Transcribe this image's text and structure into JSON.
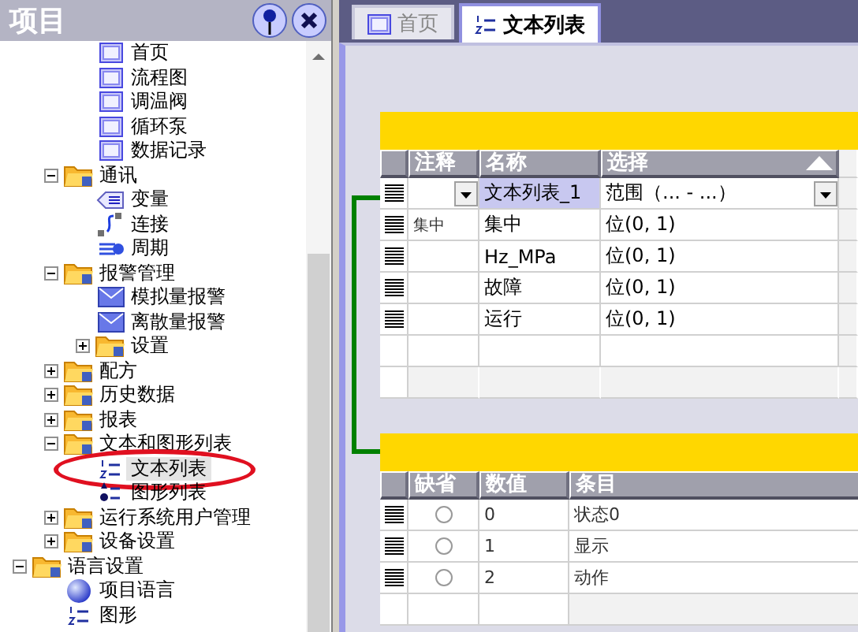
{
  "project_panel": {
    "title": "项目",
    "tree": [
      {
        "children": [
          {
            "children": [
              {
                "label": "首页",
                "kind": "screen",
                "selected": false
              },
              {
                "label": "流程图",
                "kind": "screen",
                "selected": false
              },
              {
                "label": "调温阀",
                "kind": "screen",
                "selected": false
              },
              {
                "label": "循环泵",
                "kind": "screen",
                "selected": false
              },
              {
                "label": "数据记录",
                "kind": "screen",
                "selected": false
              }
            ]
          },
          {
            "label": "通讯",
            "kind": "folder",
            "expanded": true,
            "selected": false,
            "children": [
              {
                "label": "变量",
                "kind": "tag",
                "selected": false
              },
              {
                "label": "连接",
                "kind": "link",
                "selected": false
              },
              {
                "label": "周期",
                "kind": "cycle",
                "selected": false
              }
            ]
          },
          {
            "label": "报警管理",
            "kind": "folder",
            "expanded": true,
            "selected": false,
            "children": [
              {
                "label": "模拟量报警",
                "kind": "alarm",
                "selected": false
              },
              {
                "label": "离散量报警",
                "kind": "alarm",
                "selected": false
              },
              {
                "label": "设置",
                "kind": "folder",
                "expanded": false,
                "selected": false
              }
            ]
          },
          {
            "label": "配方",
            "kind": "folder",
            "expanded": false,
            "selected": false
          },
          {
            "label": "历史数据",
            "kind": "folder",
            "expanded": false,
            "selected": false
          },
          {
            "label": "报表",
            "kind": "folder",
            "expanded": false,
            "selected": false
          },
          {
            "label": "文本和图形列表",
            "kind": "folder",
            "expanded": true,
            "selected": false,
            "children": [
              {
                "label": "文本列表",
                "kind": "textlist",
                "selected": true,
                "circled": true
              },
              {
                "label": "图形列表",
                "kind": "graphiclist",
                "selected": false
              }
            ]
          },
          {
            "label": "运行系统用户管理",
            "kind": "folder",
            "expanded": false,
            "selected": false
          },
          {
            "label": "设备设置",
            "kind": "folder",
            "expanded": false,
            "selected": false
          }
        ]
      },
      {
        "label": "语言设置",
        "kind": "folder",
        "expanded": true,
        "selected": false,
        "children": [
          {
            "label": "项目语言",
            "kind": "globe",
            "selected": false
          },
          {
            "label": "图形",
            "kind": "textlist",
            "selected": false
          }
        ]
      }
    ]
  },
  "tabs": [
    {
      "label": "首页",
      "kind": "screen",
      "selected": false
    },
    {
      "label": "文本列表",
      "kind": "textlist",
      "selected": true
    }
  ],
  "text_lists": {
    "columns": [
      "注释",
      "名称",
      "选择"
    ],
    "rows": [
      {
        "cells": [
          "",
          "文本列表_1",
          "范围（... - ...）"
        ],
        "editing": true
      },
      {
        "cells": [
          "集中",
          "集中",
          "位(0, 1)"
        ],
        "editing": false
      },
      {
        "cells": [
          "",
          "Hz_MPa",
          "位(0, 1)"
        ],
        "editing": false
      },
      {
        "cells": [
          "",
          "故障",
          "位(0, 1)"
        ],
        "editing": false
      },
      {
        "cells": [
          "",
          "运行",
          "位(0, 1)"
        ],
        "editing": false
      }
    ]
  },
  "list_entries": {
    "columns": [
      "缺省",
      "数值",
      "条目"
    ],
    "rows": [
      {
        "default": false,
        "value": "0",
        "entry": "状态0"
      },
      {
        "default": false,
        "value": "1",
        "entry": "显示"
      },
      {
        "default": false,
        "value": "2",
        "entry": "动作"
      }
    ]
  }
}
